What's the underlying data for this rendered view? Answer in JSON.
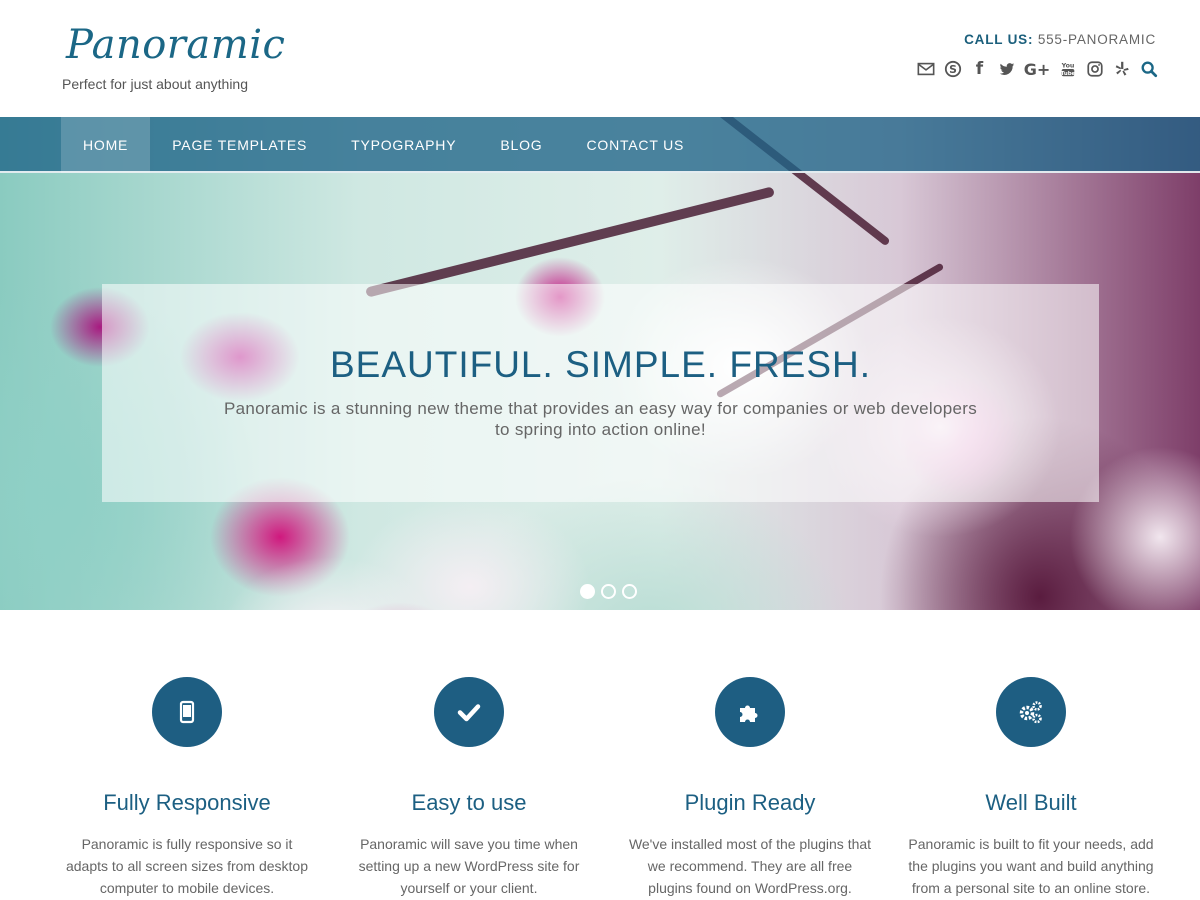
{
  "site": {
    "title": "Panoramic",
    "tagline": "Perfect for just about anything"
  },
  "contact": {
    "label": "CALL US:",
    "number": "555-PANORAMIC"
  },
  "social": [
    {
      "icon": "envelope-icon"
    },
    {
      "icon": "skype-icon"
    },
    {
      "icon": "facebook-icon",
      "glyph": "f"
    },
    {
      "icon": "twitter-icon"
    },
    {
      "icon": "google-plus-icon",
      "glyph": "G+"
    },
    {
      "icon": "youtube-icon"
    },
    {
      "icon": "instagram-icon"
    },
    {
      "icon": "yelp-icon"
    },
    {
      "icon": "search-icon"
    }
  ],
  "nav": {
    "items": [
      {
        "label": "HOME",
        "active": true
      },
      {
        "label": "PAGE TEMPLATES"
      },
      {
        "label": "TYPOGRAPHY"
      },
      {
        "label": "BLOG"
      },
      {
        "label": "CONTACT US"
      }
    ]
  },
  "slider": {
    "title": "BEAUTIFUL. SIMPLE. FRESH.",
    "text": "Panoramic is a stunning new theme that provides an easy way for companies or web developers to spring into action online!",
    "active_slide": 1,
    "slide_count": 3
  },
  "features": [
    {
      "icon": "tablet-icon",
      "title": "Fully Responsive",
      "text": "Panoramic is fully responsive so it adapts to all screen sizes from desktop computer to mobile devices."
    },
    {
      "icon": "checkmark-icon",
      "title": "Easy to use",
      "text": "Panoramic will save you time when setting up a new WordPress site for yourself or your client."
    },
    {
      "icon": "puzzle-icon",
      "title": "Plugin Ready",
      "text": "We've installed most of the plugins that we recommend. They are all free plugins found on WordPress.org."
    },
    {
      "icon": "gears-icon",
      "title": "Well Built",
      "text": "Panoramic is built to fit your needs, add the plugins you want and build anything from a personal site to an online store."
    }
  ],
  "colors": {
    "brand": "#1b6786",
    "nav_bg": "#1f6488",
    "feature_circle": "#1e5e82"
  }
}
